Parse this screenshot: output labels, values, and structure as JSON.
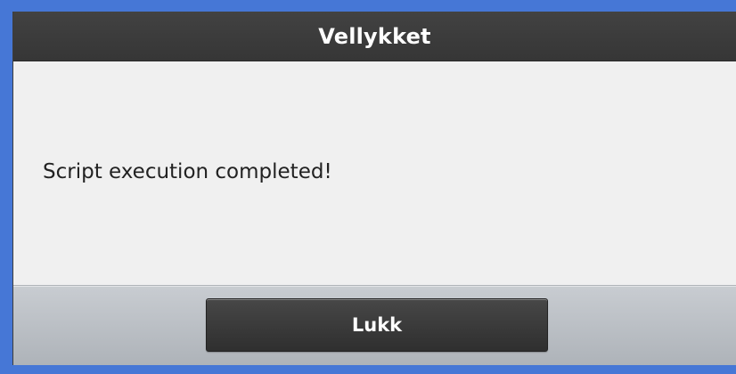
{
  "dialog": {
    "title": "Vellykket",
    "message": "Script execution completed!",
    "close_label": "Lukk"
  },
  "colors": {
    "frame": "#4677d6",
    "titlebar": "#3b3b3b",
    "body": "#f0f0f0",
    "footer": "#b8bdc2",
    "button": "#3a3a3a"
  }
}
